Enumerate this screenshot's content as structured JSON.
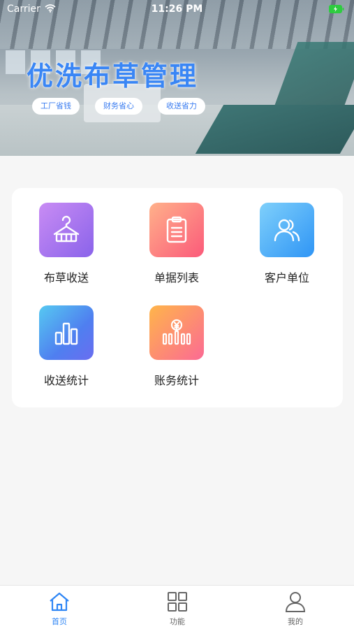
{
  "status_bar": {
    "carrier": "Carrier",
    "time": "11:26 PM"
  },
  "hero": {
    "title": "优洗布草管理",
    "tags": [
      "工厂省钱",
      "财务省心",
      "收送省力"
    ]
  },
  "menu": [
    {
      "label": "布草收送",
      "icon": "hanger-icon"
    },
    {
      "label": "单据列表",
      "icon": "clipboard-icon"
    },
    {
      "label": "客户单位",
      "icon": "users-icon"
    },
    {
      "label": "收送统计",
      "icon": "bar-chart-icon"
    },
    {
      "label": "账务统计",
      "icon": "yen-chart-icon"
    }
  ],
  "tabbar": {
    "tabs": [
      {
        "label": "首页",
        "icon": "home-icon",
        "active": true
      },
      {
        "label": "功能",
        "icon": "grid-icon",
        "active": false
      },
      {
        "label": "我的",
        "icon": "person-icon",
        "active": false
      }
    ],
    "active_color": "#2f86f5",
    "inactive_color": "#666666"
  }
}
